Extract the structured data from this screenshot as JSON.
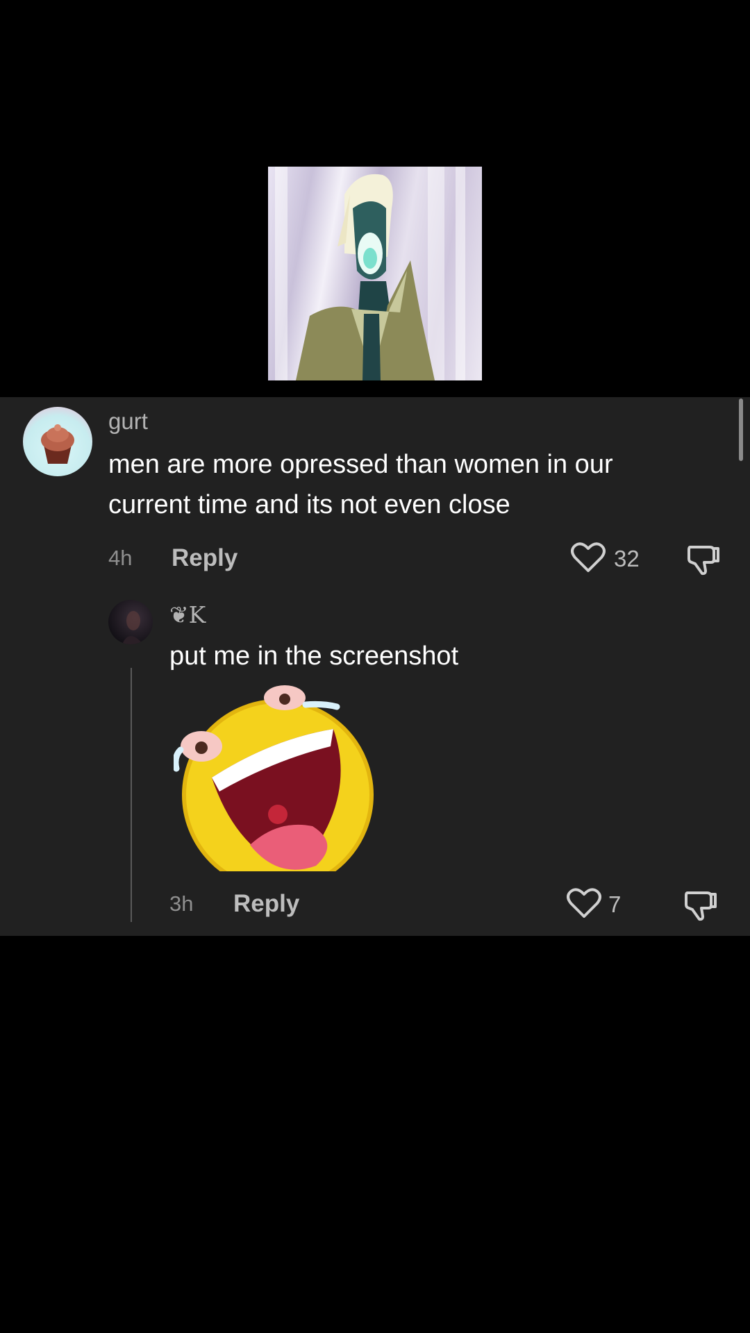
{
  "comments": [
    {
      "username": "gurt",
      "text_line1": "men are more opressed than women in our",
      "text_line2": "current time and its not even close",
      "time": "4h",
      "reply_label": "Reply",
      "likes": "32"
    },
    {
      "username": "❦K",
      "text": "put me in the screenshot",
      "time": "3h",
      "reply_label": "Reply",
      "likes": "7"
    }
  ],
  "colors": {
    "background": "#000000",
    "panel": "#212121",
    "primary_text": "#ffffff",
    "secondary_text": "#b3b3b3"
  }
}
